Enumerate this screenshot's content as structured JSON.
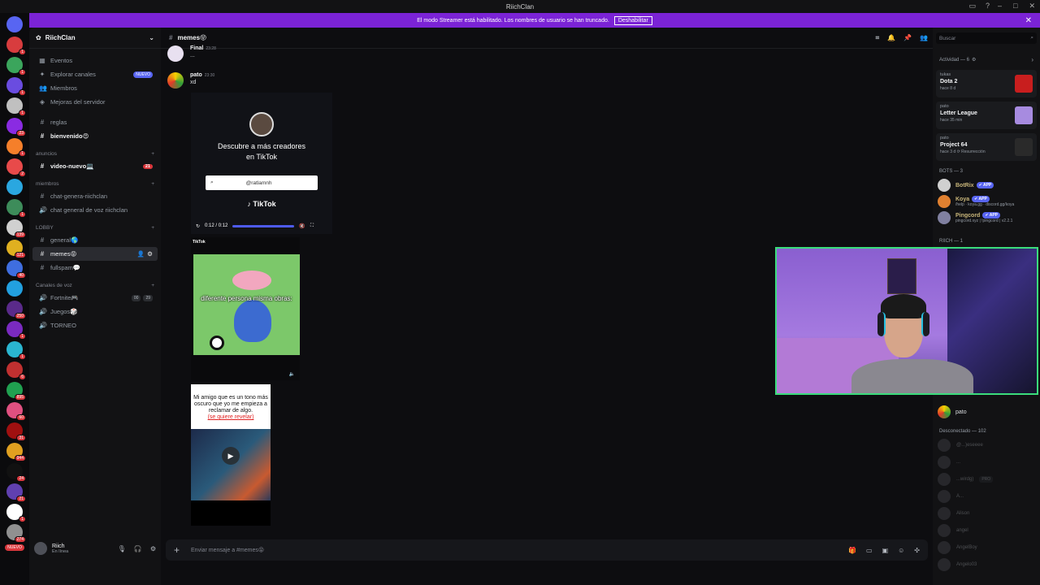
{
  "window": {
    "title": "RiichClan"
  },
  "banner": {
    "text": "El modo Streamer está habilitado. Los nombres de usuario se han truncado.",
    "button": "Deshabilitar"
  },
  "servers": [
    {
      "color": "#5865f2",
      "badge": ""
    },
    {
      "color": "#d83c3e",
      "badge": "1"
    },
    {
      "color": "#3ba55c",
      "badge": "1"
    },
    {
      "color": "#6a4ce0",
      "badge": "1"
    },
    {
      "color": "#c0c0c0",
      "badge": "1"
    },
    {
      "color": "#8a2be2",
      "badge": "23"
    },
    {
      "color": "#f57f2a",
      "badge": "1"
    },
    {
      "color": "#e84a4a",
      "badge": "2"
    },
    {
      "color": "#2aa7e0",
      "badge": ""
    },
    {
      "color": "#3d8c5a",
      "badge": "1"
    },
    {
      "color": "#d0d0d0",
      "badge": "139"
    },
    {
      "color": "#e0b020",
      "badge": "121"
    },
    {
      "color": "#3f6ee0",
      "badge": "40"
    },
    {
      "color": "#22a0e0",
      "badge": ""
    },
    {
      "color": "#5a2a8a",
      "badge": "250"
    },
    {
      "color": "#7a2ac0",
      "badge": "1"
    },
    {
      "color": "#2ab5d0",
      "badge": "1"
    },
    {
      "color": "#c03030",
      "badge": "6"
    },
    {
      "color": "#20a050",
      "badge": "895"
    },
    {
      "color": "#e05080",
      "badge": "60"
    },
    {
      "color": "#a01010",
      "badge": "31"
    },
    {
      "color": "#e0a020",
      "badge": "944"
    },
    {
      "color": "#111111",
      "badge": "24"
    },
    {
      "color": "#6040b0",
      "badge": "21"
    },
    {
      "color": "#ffffff",
      "badge": "1"
    },
    {
      "color": "#909090",
      "badge": "274"
    }
  ],
  "servers_nuevo": "NUEVO",
  "guild": {
    "name": "RiichClan",
    "top_items": [
      {
        "icon": "▦",
        "label": "Eventos"
      },
      {
        "icon": "✦",
        "label": "Explorar canales",
        "badge": "NUEVO"
      },
      {
        "icon": "👥",
        "label": "Miembros"
      },
      {
        "icon": "◈",
        "label": "Mejoras del servidor"
      }
    ],
    "channels_top": [
      {
        "label": "reglas",
        "bold": false
      },
      {
        "label": "bienvenido😍",
        "bold": true
      }
    ],
    "cat_anuncios": "anuncios",
    "anuncios": [
      {
        "label": "video-nuevo💻",
        "count": "21"
      }
    ],
    "cat_miembros": "miembros",
    "miembros": [
      {
        "icon": "#",
        "label": "chat-genera-riichclan"
      },
      {
        "icon": "🔊",
        "label": "chat general de voz riichclan"
      }
    ],
    "cat_lobby": "LOBBY",
    "lobby": [
      {
        "label": "general🌎",
        "active": false
      },
      {
        "label": "memes😝",
        "active": true
      },
      {
        "label": "fullspam💬",
        "active": false
      }
    ],
    "cat_voz": "Canales de voz",
    "voz": [
      {
        "label": "Fortnite🎮",
        "a": "00",
        "b": "29"
      },
      {
        "label": "Juegos🎲"
      },
      {
        "label": "TORNEO"
      }
    ]
  },
  "user": {
    "name": "Riich",
    "status": "En línea"
  },
  "chat": {
    "channel": "memes😝",
    "messages": [
      {
        "author": "Final",
        "time": "23:28",
        "text": "..."
      },
      {
        "author": "pato",
        "time": "23:30",
        "text": "xd"
      }
    ],
    "tiktok": {
      "title": "Descubre a más creadores en TikTok",
      "search": "@ratlamnh",
      "logo": "TikTok",
      "time": "0:12 / 0:12"
    },
    "video2": {
      "tag": "TikTok",
      "caption": "diferente persona misma obras:"
    },
    "video3": {
      "caption": "Mi amigo que es un tono más oscuro que yo me empieza a reclamar de algo.",
      "red": "(se quiere revelar)"
    },
    "composer_placeholder": "Enviar mensaje a #memes😝"
  },
  "members": {
    "search_placeholder": "Buscar",
    "activity_header": "Actividad — 6",
    "activities": [
      {
        "who": "tukas",
        "game": "Dota 2",
        "ago": "hace 8 d",
        "color": "#c81e1e"
      },
      {
        "who": "pato",
        "game": "Letter League",
        "ago": "hace 35 min",
        "color": "#a78be0"
      },
      {
        "who": "pato",
        "game": "Project 64",
        "ago": "hace 3 d  ⟳ Resurrección",
        "color": "#2a2a2a"
      }
    ],
    "bots_header": "BOTS — 3",
    "bots": [
      {
        "name": "BotRix",
        "tag": "✔ APP",
        "sub": "",
        "color": "#d0d0d0"
      },
      {
        "name": "Koya",
        "tag": "✔ APP",
        "sub": "/help · koya.gg · discord.gg/koya",
        "color": "#e08030"
      },
      {
        "name": "Pingcord",
        "tag": "✔ APP",
        "sub": "pingcord.xyz | !pingcord | v2.2.1",
        "color": "#8080a0"
      }
    ],
    "riich_header": "RIICH — 1",
    "online_name": "pato",
    "offline_header": "Desconectado — 102",
    "offline": [
      "@...)eseeee",
      "...",
      "...wirdg)",
      "A...",
      "Alison",
      "angel",
      "AngelBoy",
      "Angelo03"
    ],
    "offline_pro_tag": "PRO"
  }
}
